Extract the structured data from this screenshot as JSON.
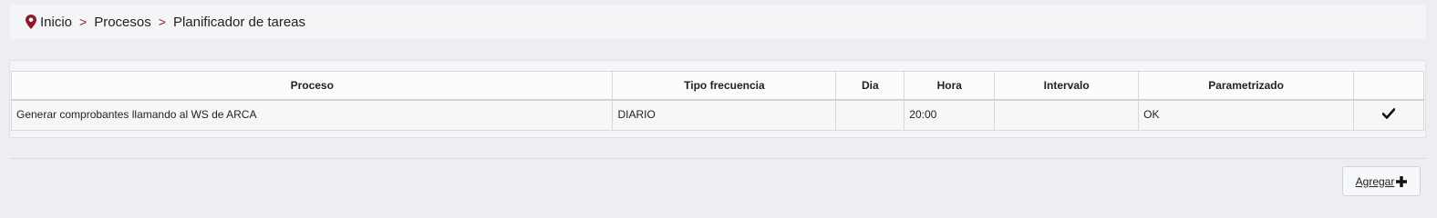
{
  "breadcrumb": {
    "items": [
      {
        "label": "Inicio",
        "icon": "map-pin-icon"
      },
      {
        "label": "Procesos"
      },
      {
        "label": "Planificador de tareas"
      }
    ],
    "separator": ">"
  },
  "table": {
    "columns": [
      "Proceso",
      "Tipo frecuencia",
      "Dia",
      "Hora",
      "Intervalo",
      "Parametrizado",
      ""
    ],
    "rows": [
      {
        "proceso": "Generar comprobantes llamando al WS de ARCA",
        "tipo_frecuencia": "DIARIO",
        "dia": "",
        "hora": "20:00",
        "intervalo": "",
        "parametrizado": "OK",
        "action_icon": "check-icon"
      }
    ]
  },
  "actions": {
    "add_label": "Agregar",
    "add_icon": "plus-icon"
  },
  "colors": {
    "accent": "#8b1a2b",
    "background": "#eceef2"
  }
}
